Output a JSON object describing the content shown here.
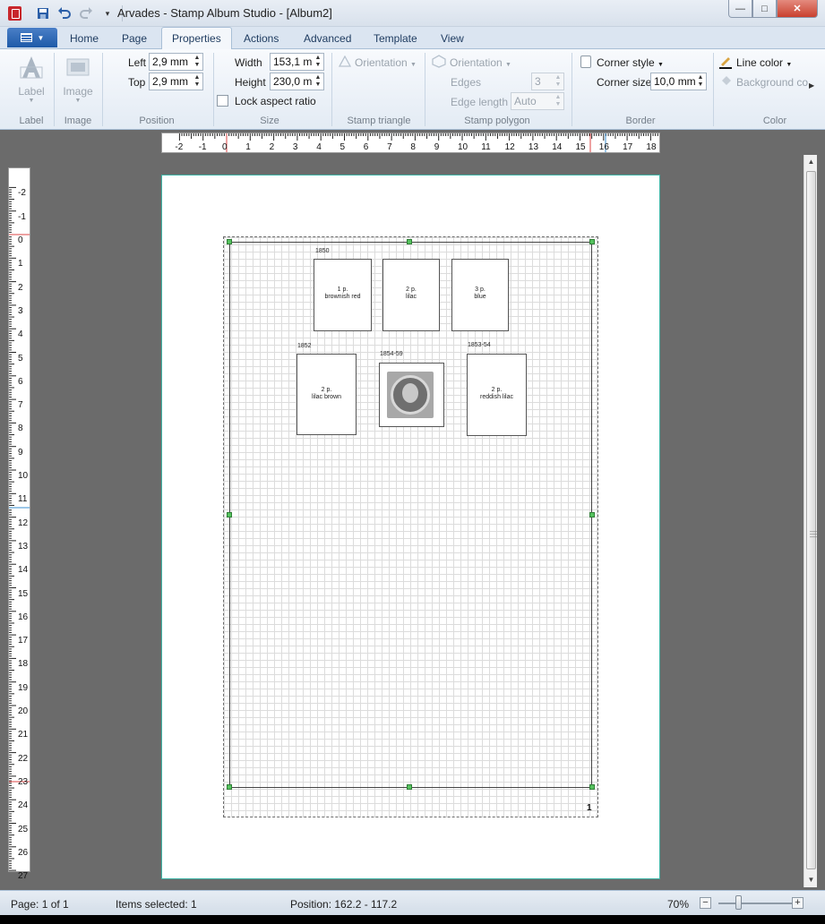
{
  "window": {
    "title": "Arvades - Stamp Album Studio - [Album2]"
  },
  "tabs": [
    "Home",
    "Page",
    "Properties",
    "Actions",
    "Advanced",
    "Template",
    "View"
  ],
  "active_tab": "Properties",
  "ribbon": {
    "label_group": {
      "button": "Label",
      "group": "Label"
    },
    "image_group": {
      "button": "Image",
      "group": "Image"
    },
    "position": {
      "group": "Position",
      "left_label": "Left",
      "left_value": "2,9 mm",
      "top_label": "Top",
      "top_value": "2,9 mm"
    },
    "size": {
      "group": "Size",
      "width_label": "Width",
      "width_value": "153,1 m",
      "height_label": "Height",
      "height_value": "230,0 m",
      "lock_label": "Lock aspect ratio"
    },
    "triangle": {
      "group": "Stamp triangle",
      "orientation": "Orientation"
    },
    "polygon": {
      "group": "Stamp polygon",
      "orientation": "Orientation",
      "edges_label": "Edges",
      "edges_value": "3",
      "edge_length_label": "Edge length",
      "edge_length_value": "Auto"
    },
    "border": {
      "group": "Border",
      "corner_style": "Corner style",
      "corner_size_label": "Corner size",
      "corner_size_value": "10,0 mm"
    },
    "color": {
      "group": "Color",
      "line_color": "Line color",
      "background": "Background co"
    }
  },
  "ruler_h": [
    "-2",
    "-1",
    "0",
    "1",
    "2",
    "3",
    "4",
    "5",
    "6",
    "7",
    "8",
    "9",
    "10",
    "11",
    "12",
    "13",
    "14",
    "15",
    "16",
    "17",
    "18"
  ],
  "ruler_v": [
    "-2",
    "-1",
    "0",
    "1",
    "2",
    "3",
    "4",
    "5",
    "6",
    "7",
    "8",
    "9",
    "10",
    "11",
    "12",
    "13",
    "14",
    "15",
    "16",
    "17",
    "18",
    "19",
    "20",
    "21",
    "22",
    "23",
    "24",
    "25",
    "26",
    "27"
  ],
  "album": {
    "page_number": "1",
    "groups": [
      {
        "year": "1850"
      },
      {
        "year": "1852"
      },
      {
        "year": "1854-59"
      },
      {
        "year": "1853-54"
      }
    ],
    "stamps": [
      {
        "denomination": "1 p.",
        "color": "brownish red"
      },
      {
        "denomination": "2 p.",
        "color": "lilac"
      },
      {
        "denomination": "3 p.",
        "color": "blue"
      },
      {
        "denomination": "2 p.",
        "color": "lilac brown"
      },
      {
        "denomination": "2 p.",
        "color": "reddish lilac"
      }
    ]
  },
  "status": {
    "page": "Page: 1 of 1",
    "items_selected": "Items selected: 1",
    "position": "Position: 162.2 - 117.2",
    "zoom": "70%"
  },
  "colors": {
    "accent": "#1e5aa8",
    "page_border": "#3fb4a6",
    "handle": "#56c35f",
    "workspace": "#6b6b6b"
  }
}
